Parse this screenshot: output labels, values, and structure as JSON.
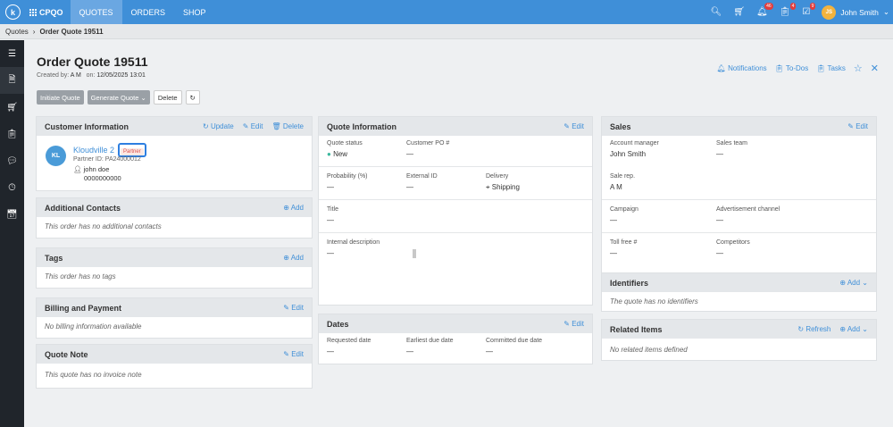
{
  "topbar": {
    "logo": "k",
    "brand": "CPQO",
    "nav": [
      "QUOTES",
      "ORDERS",
      "SHOP"
    ],
    "badges": {
      "notifications": "46",
      "tasks": "4",
      "todos": "9"
    },
    "user_initials": "JS",
    "user_name": "John Smith"
  },
  "breadcrumb": {
    "root": "Quotes",
    "current": "Order Quote 19511"
  },
  "page": {
    "title": "Order Quote 19511",
    "created_by_label": "Created by:",
    "created_by": "A M",
    "on_label": "on:",
    "created_on": "12/05/2025 13:01",
    "actions": {
      "initiate": "Initiate Quote",
      "generate": "Generate Quote",
      "delete": "Delete"
    },
    "top_links": {
      "notifications": "Notifications",
      "todos": "To-Dos",
      "tasks": "Tasks"
    }
  },
  "customer": {
    "header": "Customer Information",
    "update": "Update",
    "edit": "Edit",
    "delete": "Delete",
    "initials": "KL",
    "name": "Kloudville 2",
    "badge": "Partner",
    "partner_id": "Partner ID: PA24000012",
    "contact": "john doe",
    "phone": "0000000000"
  },
  "additional_contacts": {
    "header": "Additional Contacts",
    "add": "Add",
    "empty": "This order has no additional contacts"
  },
  "tags": {
    "header": "Tags",
    "add": "Add",
    "empty": "This order has no tags"
  },
  "billing": {
    "header": "Billing and Payment",
    "edit": "Edit",
    "empty": "No billing information available"
  },
  "quote_note": {
    "header": "Quote Note",
    "edit": "Edit",
    "empty": "This quote has no invoice note"
  },
  "quote_info": {
    "header": "Quote Information",
    "edit": "Edit",
    "status_label": "Quote status",
    "status_value": "New",
    "po_label": "Customer PO #",
    "po_value": "—",
    "prob_label": "Probability (%)",
    "prob_value": "—",
    "ext_label": "External ID",
    "ext_value": "—",
    "delivery_label": "Delivery",
    "delivery_value": "Shipping",
    "title_label": "Title",
    "title_value": "—",
    "desc_label": "Internal description",
    "desc_value": "—"
  },
  "dates": {
    "header": "Dates",
    "edit": "Edit",
    "req_label": "Requested date",
    "req_value": "—",
    "early_label": "Earliest due date",
    "early_value": "—",
    "commit_label": "Committed due date",
    "commit_value": "—"
  },
  "sales": {
    "header": "Sales",
    "edit": "Edit",
    "am_label": "Account manager",
    "am_value": "John Smith",
    "team_label": "Sales team",
    "team_value": "—",
    "rep_label": "Sale rep.",
    "rep_value": "A M",
    "camp_label": "Campaign",
    "camp_value": "—",
    "adv_label": "Advertisement channel",
    "adv_value": "—",
    "toll_label": "Toll free #",
    "toll_value": "—",
    "comp_label": "Competitors",
    "comp_value": "—"
  },
  "identifiers": {
    "header": "Identifiers",
    "add": "Add",
    "empty": "The quote has no identifiers"
  },
  "related": {
    "header": "Related Items",
    "refresh": "Refresh",
    "add": "Add",
    "empty": "No related items defined"
  },
  "colors": {
    "accent": "#3f8fd8",
    "sidebar": "#20252b",
    "badge": "#e23d3d"
  }
}
